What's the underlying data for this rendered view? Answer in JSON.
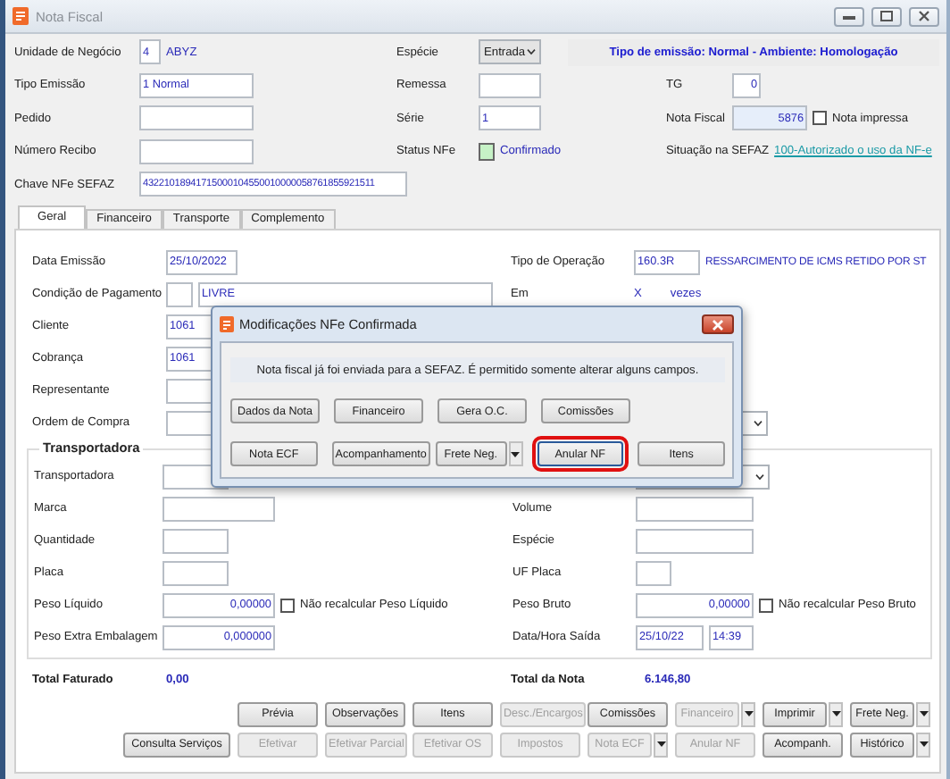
{
  "window": {
    "title": "Nota Fiscal"
  },
  "header": {
    "business_unit": {
      "label": "Unidade de Negócio",
      "code": "4",
      "name": "ABYZ"
    },
    "species": {
      "label": "Espécie",
      "value": "Entrada"
    },
    "emission_info": "Tipo de emissão: Normal - Ambiente: Homologação",
    "emission_type": {
      "label": "Tipo Emissão",
      "value": "1 Normal"
    },
    "shipment": {
      "label": "Remessa"
    },
    "tg": {
      "label": "TG",
      "value": "0"
    },
    "order": {
      "label": "Pedido"
    },
    "series": {
      "label": "Série",
      "value": "1"
    },
    "invoice": {
      "label": "Nota Fiscal",
      "value": "5876"
    },
    "printed": {
      "label": "Nota impressa",
      "checked": false
    },
    "receipt": {
      "label": "Número Recibo"
    },
    "nfe_status": {
      "label": "Status NFe",
      "value": "Confirmado"
    },
    "sefaz_status": {
      "label": "Situação na SEFAZ",
      "link": "100-Autorizado o uso da NF-e"
    },
    "access_key": {
      "label": "Chave NFe SEFAZ",
      "value": "43221018941715000104550010000058761855921511"
    }
  },
  "tabs": [
    {
      "label": "Geral",
      "selected": true
    },
    {
      "label": "Financeiro",
      "selected": false
    },
    {
      "label": "Transporte",
      "selected": false
    },
    {
      "label": "Complemento",
      "selected": false
    }
  ],
  "general": {
    "issue_date": {
      "label": "Data Emissão",
      "value": "25/10/2022"
    },
    "operation_type": {
      "label": "Tipo de Operação",
      "code": "160.3R",
      "description": "RESSARCIMENTO DE ICMS RETIDO POR ST"
    },
    "payment_condition": {
      "label": "Condição de Pagamento",
      "value": "LIVRE"
    },
    "installments": {
      "label": "Em",
      "count": "X",
      "unit": "vezes"
    },
    "customer": {
      "label": "Cliente",
      "value": "1061"
    },
    "billing": {
      "label": "Cobrança",
      "value": "1061"
    },
    "representative": {
      "label": "Representante"
    },
    "purchase_order": {
      "label": "Ordem de Compra"
    }
  },
  "carrier": {
    "title": "Transportadora",
    "carrier": {
      "label": "Transportadora"
    },
    "brand": {
      "label": "Marca"
    },
    "volume": {
      "label": "Volume"
    },
    "quantity": {
      "label": "Quantidade"
    },
    "species": {
      "label": "Espécie"
    },
    "plate": {
      "label": "Placa"
    },
    "plate_state": {
      "label": "UF Placa"
    },
    "net_weight": {
      "label": "Peso Líquido",
      "value": "0,00000",
      "no_recalc": {
        "label": "Não recalcular Peso Líquido",
        "checked": false
      }
    },
    "gross_weight": {
      "label": "Peso Bruto",
      "value": "0,00000",
      "no_recalc": {
        "label": "Não recalcular Peso Bruto",
        "checked": false
      }
    },
    "extra_weight": {
      "label": "Peso Extra Embalagem",
      "value": "0,000000"
    },
    "departure": {
      "label": "Data/Hora Saída",
      "date": "25/10/22",
      "time": "14:39"
    }
  },
  "totals": [
    {
      "label": "Total Faturado",
      "value": "0,00"
    },
    {
      "label": "Total da Nota",
      "value": "6.146,80"
    }
  ],
  "toolbar": [
    [
      {
        "label": "Prévia",
        "disabled": false,
        "menu": false
      },
      {
        "label": "Observações",
        "disabled": false,
        "menu": false
      },
      {
        "label": "Itens",
        "disabled": false,
        "menu": false
      },
      {
        "label": "Desc./Encargos",
        "disabled": true,
        "menu": false
      },
      {
        "label": "Comissões",
        "disabled": false,
        "menu": false
      },
      {
        "label": "Financeiro",
        "disabled": true,
        "menu": true
      },
      {
        "label": "Imprimir",
        "disabled": false,
        "menu": true
      },
      {
        "label": "Frete Neg.",
        "disabled": false,
        "menu": true
      }
    ],
    [
      {
        "label": "Consulta Serviços",
        "disabled": false,
        "menu": false
      },
      {
        "label": "Efetivar",
        "disabled": true,
        "menu": false
      },
      {
        "label": "Efetivar Parcial",
        "disabled": true,
        "menu": false
      },
      {
        "label": "Efetivar OS",
        "disabled": true,
        "menu": false
      },
      {
        "label": "Impostos",
        "disabled": true,
        "menu": false
      },
      {
        "label": "Nota ECF",
        "disabled": true,
        "menu": true
      },
      {
        "label": "Anular NF",
        "disabled": true,
        "menu": false
      },
      {
        "label": "Acompanh.",
        "disabled": false,
        "menu": false
      },
      {
        "label": "Histórico",
        "disabled": false,
        "menu": true
      }
    ]
  ],
  "dialog": {
    "title": "Modificações NFe Confirmada",
    "message": "Nota fiscal já foi enviada para a SEFAZ. É permitido somente alterar alguns campos.",
    "buttons": [
      [
        {
          "label": "Dados da Nota",
          "highlighted": false,
          "menu": false
        },
        {
          "label": "Financeiro",
          "highlighted": false,
          "menu": false
        },
        {
          "label": "Gera O.C.",
          "highlighted": false,
          "menu": false
        },
        {
          "label": "Comissões",
          "highlighted": false,
          "menu": false
        }
      ],
      [
        {
          "label": "Nota ECF",
          "highlighted": false,
          "menu": false
        },
        {
          "label": "Acompanhamento",
          "highlighted": false,
          "menu": false
        },
        {
          "label": "Frete Neg.",
          "highlighted": false,
          "menu": true
        },
        {
          "label": "Anular NF",
          "highlighted": true,
          "menu": false
        },
        {
          "label": "Itens",
          "highlighted": false,
          "menu": false
        }
      ]
    ]
  }
}
